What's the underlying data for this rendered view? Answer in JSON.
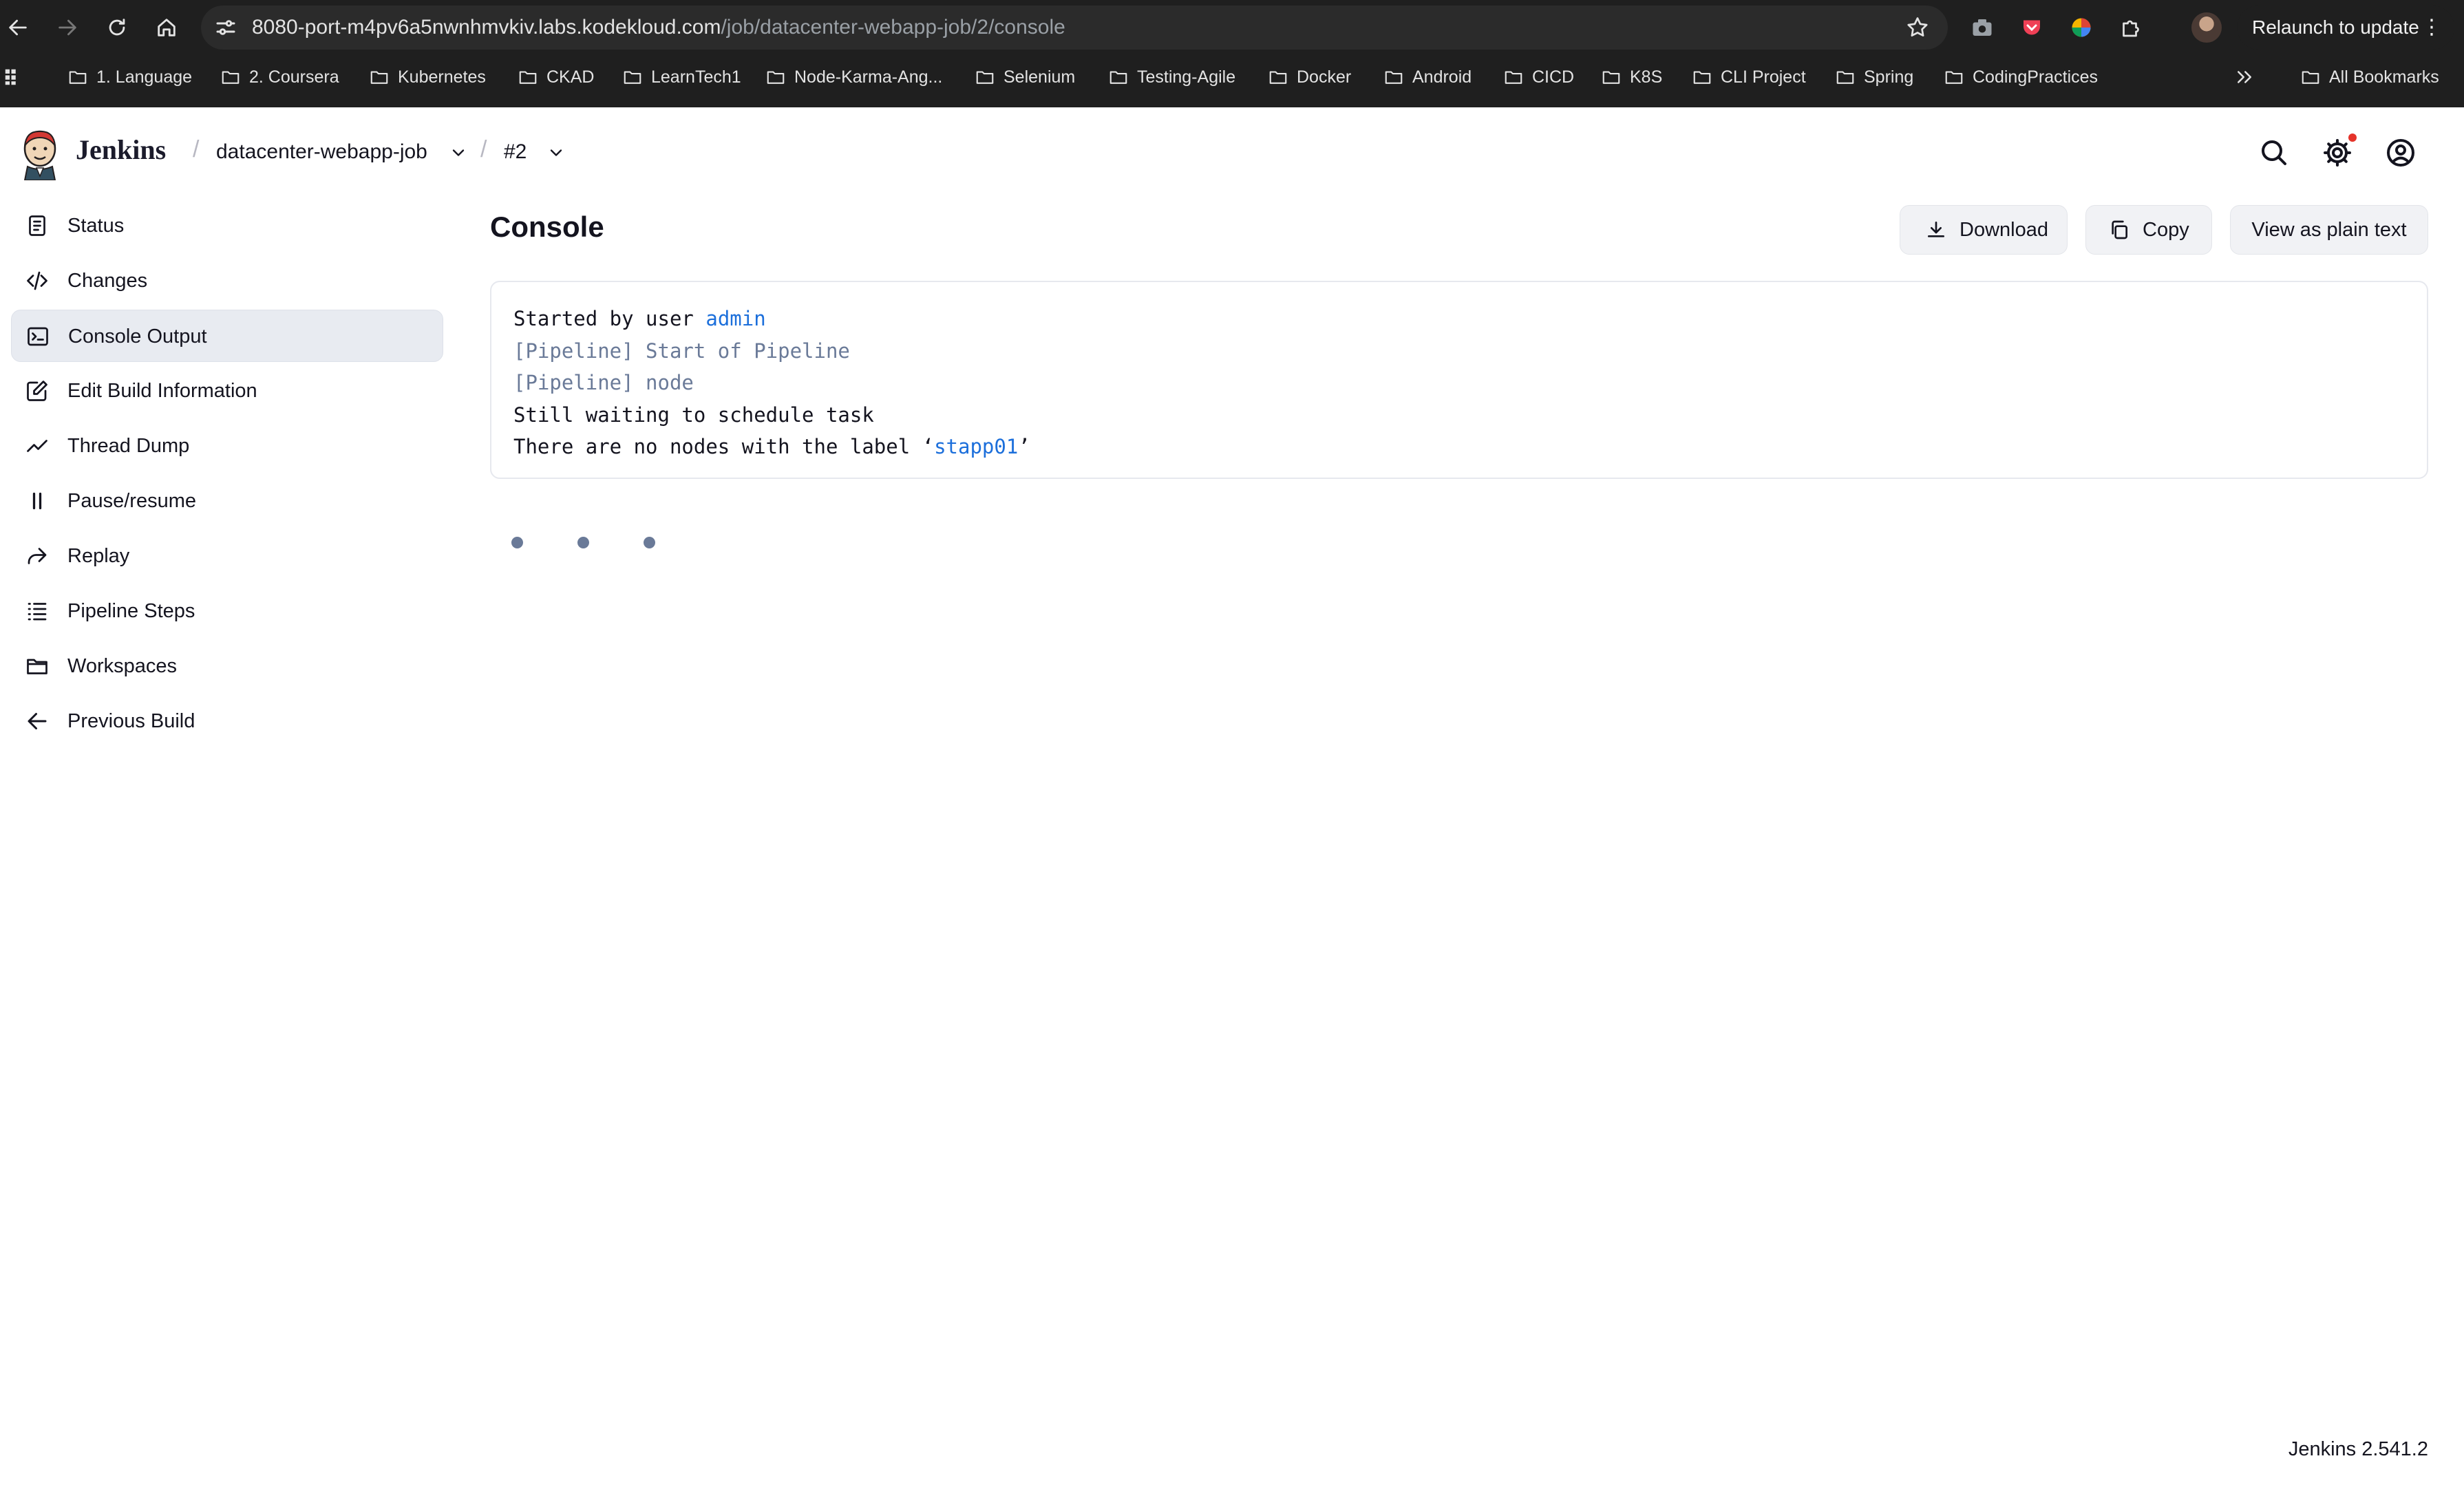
{
  "browser": {
    "url_host": "8080-port-m4pv6a5nwnhmvkiv.labs.kodekloud.com",
    "url_path": "/job/datacenter-webapp-job/2/console",
    "relaunch_label": "Relaunch to update",
    "bookmarks": [
      "1. Language",
      "2. Coursera",
      "Kubernetes",
      "CKAD",
      "LearnTech1",
      "Node-Karma-Ang...",
      "Selenium",
      "Testing-Agile",
      "Docker",
      "Android",
      "CICD",
      "K8S",
      "CLI Project",
      "Spring",
      "CodingPractices"
    ],
    "all_bookmarks_label": "All Bookmarks"
  },
  "header": {
    "app_name": "Jenkins",
    "breadcrumb_job": "datacenter-webapp-job",
    "breadcrumb_build": "#2"
  },
  "sidebar": {
    "items": [
      {
        "label": "Status",
        "icon": "document-icon"
      },
      {
        "label": "Changes",
        "icon": "code-icon"
      },
      {
        "label": "Console Output",
        "icon": "terminal-icon",
        "active": true
      },
      {
        "label": "Edit Build Information",
        "icon": "edit-icon"
      },
      {
        "label": "Thread Dump",
        "icon": "chart-line-icon"
      },
      {
        "label": "Pause/resume",
        "icon": "pause-icon"
      },
      {
        "label": "Replay",
        "icon": "replay-icon"
      },
      {
        "label": "Pipeline Steps",
        "icon": "list-icon"
      },
      {
        "label": "Workspaces",
        "icon": "folder-icon"
      },
      {
        "label": "Previous Build",
        "icon": "arrow-left-icon"
      }
    ]
  },
  "main": {
    "title": "Console",
    "actions": {
      "download": "Download",
      "copy": "Copy",
      "plain_text": "View as plain text"
    },
    "console": {
      "line1_prefix": "Started by user ",
      "line1_user": "admin",
      "line2": "[Pipeline] Start of Pipeline",
      "line3": "[Pipeline] node",
      "line4": "Still waiting to schedule task",
      "line5_prefix": "There are no nodes with the label ‘",
      "line5_label": "stapp01",
      "line5_suffix": "’"
    }
  },
  "footer": {
    "version": "Jenkins 2.541.2"
  },
  "colors": {
    "link": "#1c6fdb",
    "pipeline_text": "#6a7a98",
    "active_item_bg": "#e8ebf1",
    "chrome_bg": "#1f1f1f"
  }
}
